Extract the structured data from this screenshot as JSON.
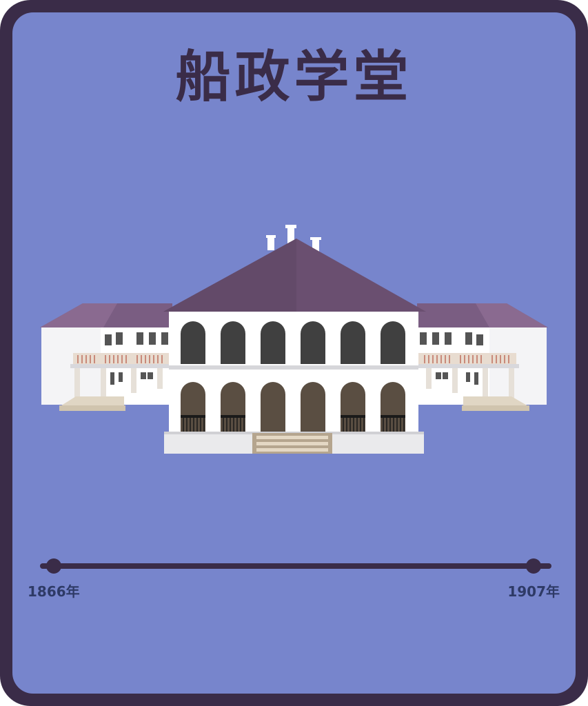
{
  "title": "船政学堂",
  "timeline": {
    "start_label": "1866年",
    "end_label": "1907年"
  },
  "colors": {
    "frame": "#3a2c48",
    "background": "#7785cc",
    "roof": "#6a4f70",
    "wall": "#ffffff",
    "window": "#404040",
    "door": "#5a4e42"
  },
  "illustration": {
    "subject": "building-illustration"
  }
}
